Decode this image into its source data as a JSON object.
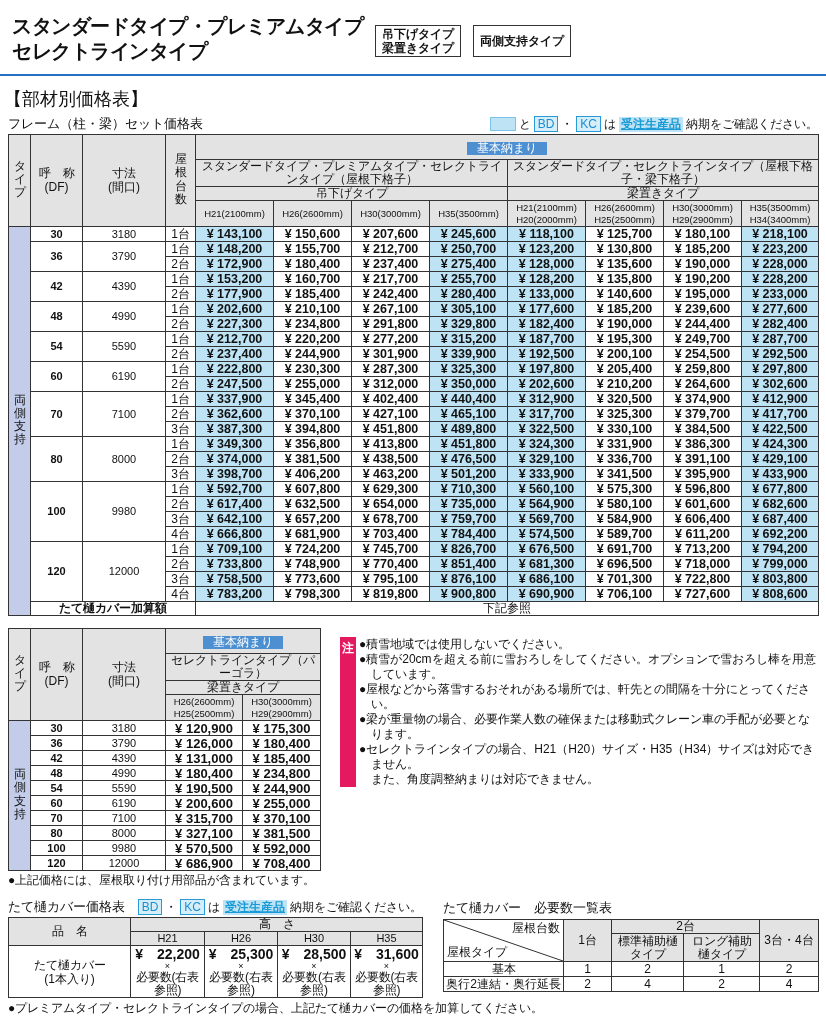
{
  "heading": {
    "title_lines": [
      "スタンダードタイプ・プレミアムタイプ",
      "セレクトラインタイプ"
    ],
    "tags": [
      {
        "lines": [
          "吊下げタイプ",
          "梁置きタイプ"
        ]
      },
      {
        "lines": [
          "両側支持タイプ"
        ]
      }
    ]
  },
  "section_title": "【部材別価格表】",
  "frame_table": {
    "title": "フレーム（柱・梁）セット価格表",
    "legend": [
      {
        "kind": "swatch"
      },
      {
        "kind": "text",
        "text": "と"
      },
      {
        "kind": "code",
        "text": "BD"
      },
      {
        "kind": "text",
        "text": "・"
      },
      {
        "kind": "code",
        "text": "KC"
      },
      {
        "kind": "text",
        "text": "は"
      },
      {
        "kind": "tag",
        "text": "受注生産品"
      },
      {
        "kind": "text",
        "text": "納期をご確認ください。"
      }
    ],
    "headers": {
      "type": "タイプ",
      "name": [
        "呼　称",
        "(DF)"
      ],
      "size": [
        "寸法",
        "(間口)"
      ],
      "count": "屋根台数"
    },
    "badge": "基本納まり",
    "groups": [
      {
        "label": "スタンダードタイプ・プレミアムタイプ・セレクトラインタイプ（屋根下格子）",
        "subtype": "吊下げタイプ"
      },
      {
        "label": "スタンダードタイプ・セレクトラインタイプ（屋根下格子・梁下格子）",
        "subtype": "梁置きタイプ"
      }
    ],
    "price_columns": [
      {
        "lines": [
          "H21(2100mm)"
        ],
        "highlighted": true
      },
      {
        "lines": [
          "H26(2600mm)"
        ],
        "highlighted": false
      },
      {
        "lines": [
          "H30(3000mm)"
        ],
        "highlighted": false
      },
      {
        "lines": [
          "H35(3500mm)"
        ],
        "highlighted": true
      },
      {
        "lines": [
          "H21(2100mm)",
          "H20(2000mm)"
        ],
        "highlighted": true
      },
      {
        "lines": [
          "H26(2600mm)",
          "H25(2500mm)"
        ],
        "highlighted": false
      },
      {
        "lines": [
          "H30(3000mm)",
          "H29(2900mm)"
        ],
        "highlighted": false
      },
      {
        "lines": [
          "H35(3500mm)",
          "H34(3400mm)"
        ],
        "highlighted": true
      }
    ],
    "type_label": "両側支持",
    "rows": [
      {
        "name": "30",
        "size": "3180",
        "units": [
          {
            "count": "1台",
            "prices": [
              "¥ 143,100",
              "¥ 150,600",
              "¥ 207,600",
              "¥ 245,600",
              "¥ 118,100",
              "¥ 125,700",
              "¥ 180,100",
              "¥ 218,100"
            ]
          }
        ]
      },
      {
        "name": "36",
        "size": "3790",
        "units": [
          {
            "count": "1台",
            "prices": [
              "¥ 148,200",
              "¥ 155,700",
              "¥ 212,700",
              "¥ 250,700",
              "¥ 123,200",
              "¥ 130,800",
              "¥ 185,200",
              "¥ 223,200"
            ]
          },
          {
            "count": "2台",
            "prices": [
              "¥ 172,900",
              "¥ 180,400",
              "¥ 237,400",
              "¥ 275,400",
              "¥ 128,000",
              "¥ 135,600",
              "¥ 190,000",
              "¥ 228,000"
            ]
          }
        ]
      },
      {
        "name": "42",
        "size": "4390",
        "units": [
          {
            "count": "1台",
            "prices": [
              "¥ 153,200",
              "¥ 160,700",
              "¥ 217,700",
              "¥ 255,700",
              "¥ 128,200",
              "¥ 135,800",
              "¥ 190,200",
              "¥ 228,200"
            ]
          },
          {
            "count": "2台",
            "prices": [
              "¥ 177,900",
              "¥ 185,400",
              "¥ 242,400",
              "¥ 280,400",
              "¥ 133,000",
              "¥ 140,600",
              "¥ 195,000",
              "¥ 233,000"
            ]
          }
        ]
      },
      {
        "name": "48",
        "size": "4990",
        "units": [
          {
            "count": "1台",
            "prices": [
              "¥ 202,600",
              "¥ 210,100",
              "¥ 267,100",
              "¥ 305,100",
              "¥ 177,600",
              "¥ 185,200",
              "¥ 239,600",
              "¥ 277,600"
            ]
          },
          {
            "count": "2台",
            "prices": [
              "¥ 227,300",
              "¥ 234,800",
              "¥ 291,800",
              "¥ 329,800",
              "¥ 182,400",
              "¥ 190,000",
              "¥ 244,400",
              "¥ 282,400"
            ]
          }
        ]
      },
      {
        "name": "54",
        "size": "5590",
        "units": [
          {
            "count": "1台",
            "prices": [
              "¥ 212,700",
              "¥ 220,200",
              "¥ 277,200",
              "¥ 315,200",
              "¥ 187,700",
              "¥ 195,300",
              "¥ 249,700",
              "¥ 287,700"
            ]
          },
          {
            "count": "2台",
            "prices": [
              "¥ 237,400",
              "¥ 244,900",
              "¥ 301,900",
              "¥ 339,900",
              "¥ 192,500",
              "¥ 200,100",
              "¥ 254,500",
              "¥ 292,500"
            ]
          }
        ]
      },
      {
        "name": "60",
        "size": "6190",
        "units": [
          {
            "count": "1台",
            "prices": [
              "¥ 222,800",
              "¥ 230,300",
              "¥ 287,300",
              "¥ 325,300",
              "¥ 197,800",
              "¥ 205,400",
              "¥ 259,800",
              "¥ 297,800"
            ]
          },
          {
            "count": "2台",
            "prices": [
              "¥ 247,500",
              "¥ 255,000",
              "¥ 312,000",
              "¥ 350,000",
              "¥ 202,600",
              "¥ 210,200",
              "¥ 264,600",
              "¥ 302,600"
            ]
          }
        ]
      },
      {
        "name": "70",
        "size": "7100",
        "units": [
          {
            "count": "1台",
            "prices": [
              "¥ 337,900",
              "¥ 345,400",
              "¥ 402,400",
              "¥ 440,400",
              "¥ 312,900",
              "¥ 320,500",
              "¥ 374,900",
              "¥ 412,900"
            ]
          },
          {
            "count": "2台",
            "prices": [
              "¥ 362,600",
              "¥ 370,100",
              "¥ 427,100",
              "¥ 465,100",
              "¥ 317,700",
              "¥ 325,300",
              "¥ 379,700",
              "¥ 417,700"
            ]
          },
          {
            "count": "3台",
            "prices": [
              "¥ 387,300",
              "¥ 394,800",
              "¥ 451,800",
              "¥ 489,800",
              "¥ 322,500",
              "¥ 330,100",
              "¥ 384,500",
              "¥ 422,500"
            ]
          }
        ]
      },
      {
        "name": "80",
        "size": "8000",
        "units": [
          {
            "count": "1台",
            "prices": [
              "¥ 349,300",
              "¥ 356,800",
              "¥ 413,800",
              "¥ 451,800",
              "¥ 324,300",
              "¥ 331,900",
              "¥ 386,300",
              "¥ 424,300"
            ]
          },
          {
            "count": "2台",
            "prices": [
              "¥ 374,000",
              "¥ 381,500",
              "¥ 438,500",
              "¥ 476,500",
              "¥ 329,100",
              "¥ 336,700",
              "¥ 391,100",
              "¥ 429,100"
            ]
          },
          {
            "count": "3台",
            "prices": [
              "¥ 398,700",
              "¥ 406,200",
              "¥ 463,200",
              "¥ 501,200",
              "¥ 333,900",
              "¥ 341,500",
              "¥ 395,900",
              "¥ 433,900"
            ]
          }
        ]
      },
      {
        "name": "100",
        "size": "9980",
        "units": [
          {
            "count": "1台",
            "prices": [
              "¥ 592,700",
              "¥ 607,800",
              "¥ 629,300",
              "¥ 710,300",
              "¥ 560,100",
              "¥ 575,300",
              "¥ 596,800",
              "¥ 677,800"
            ]
          },
          {
            "count": "2台",
            "prices": [
              "¥ 617,400",
              "¥ 632,500",
              "¥ 654,000",
              "¥ 735,000",
              "¥ 564,900",
              "¥ 580,100",
              "¥ 601,600",
              "¥ 682,600"
            ]
          },
          {
            "count": "3台",
            "prices": [
              "¥ 642,100",
              "¥ 657,200",
              "¥ 678,700",
              "¥ 759,700",
              "¥ 569,700",
              "¥ 584,900",
              "¥ 606,400",
              "¥ 687,400"
            ]
          },
          {
            "count": "4台",
            "prices": [
              "¥ 666,800",
              "¥ 681,900",
              "¥ 703,400",
              "¥ 784,400",
              "¥ 574,500",
              "¥ 589,700",
              "¥ 611,200",
              "¥ 692,200"
            ]
          }
        ]
      },
      {
        "name": "120",
        "size": "12000",
        "units": [
          {
            "count": "1台",
            "prices": [
              "¥ 709,100",
              "¥ 724,200",
              "¥ 745,700",
              "¥ 826,700",
              "¥ 676,500",
              "¥ 691,700",
              "¥ 713,200",
              "¥ 794,200"
            ]
          },
          {
            "count": "2台",
            "prices": [
              "¥ 733,800",
              "¥ 748,900",
              "¥ 770,400",
              "¥ 851,400",
              "¥ 681,300",
              "¥ 696,500",
              "¥ 718,000",
              "¥ 799,000"
            ]
          },
          {
            "count": "3台",
            "prices": [
              "¥ 758,500",
              "¥ 773,600",
              "¥ 795,100",
              "¥ 876,100",
              "¥ 686,100",
              "¥ 701,300",
              "¥ 722,800",
              "¥ 803,800"
            ]
          },
          {
            "count": "4台",
            "prices": [
              "¥ 783,200",
              "¥ 798,300",
              "¥ 819,800",
              "¥ 900,800",
              "¥ 690,900",
              "¥ 706,100",
              "¥ 727,600",
              "¥ 808,600"
            ]
          }
        ]
      }
    ],
    "footer": {
      "label": "たて樋カバー加算額",
      "value": "下記参照"
    }
  },
  "selectline_table": {
    "headers": {
      "type": "タイプ",
      "name": [
        "呼　称",
        "(DF)"
      ],
      "size": [
        "寸法",
        "(間口)"
      ]
    },
    "badge": "基本納まり",
    "group": "セレクトラインタイプ（パーゴラ）",
    "subtype": "梁置きタイプ",
    "price_columns": [
      {
        "lines": [
          "H26(2600mm)",
          "H25(2500mm)"
        ]
      },
      {
        "lines": [
          "H30(3000mm)",
          "H29(2900mm)"
        ]
      }
    ],
    "type_label": "両側支持",
    "rows": [
      {
        "name": "30",
        "size": "3180",
        "prices": [
          "¥ 120,900",
          "¥ 175,300"
        ]
      },
      {
        "name": "36",
        "size": "3790",
        "prices": [
          "¥ 126,000",
          "¥ 180,400"
        ]
      },
      {
        "name": "42",
        "size": "4390",
        "prices": [
          "¥ 131,000",
          "¥ 185,400"
        ]
      },
      {
        "name": "48",
        "size": "4990",
        "prices": [
          "¥ 180,400",
          "¥ 234,800"
        ]
      },
      {
        "name": "54",
        "size": "5590",
        "prices": [
          "¥ 190,500",
          "¥ 244,900"
        ]
      },
      {
        "name": "60",
        "size": "6190",
        "prices": [
          "¥ 200,600",
          "¥ 255,000"
        ]
      },
      {
        "name": "70",
        "size": "7100",
        "prices": [
          "¥ 315,700",
          "¥ 370,100"
        ]
      },
      {
        "name": "80",
        "size": "8000",
        "prices": [
          "¥ 327,100",
          "¥ 381,500"
        ]
      },
      {
        "name": "100",
        "size": "9980",
        "prices": [
          "¥ 570,500",
          "¥ 592,000"
        ]
      },
      {
        "name": "120",
        "size": "12000",
        "prices": [
          "¥ 686,900",
          "¥ 708,400"
        ]
      }
    ],
    "footnote": "●上記価格には、屋根取り付け用部品が含まれています。"
  },
  "notes": {
    "marker": "注",
    "items": [
      {
        "kind": "bullet",
        "text": "●積雪地域では使用しないでください。"
      },
      {
        "kind": "bullet",
        "text": "●積雪が20cmを超える前に雪おろしをしてください。オプションで雪おろし棒を用意しています。"
      },
      {
        "kind": "bullet",
        "text": "●屋根などから落雪するおそれがある場所では、軒先との間隔を十分にとってください。"
      },
      {
        "kind": "bullet",
        "text": "●梁が重量物の場合、必要作業人数の確保または移動式クレーン車の手配が必要となります。"
      },
      {
        "kind": "bullet",
        "text": "●セレクトラインタイプの場合、H21（H20）サイズ・H35（H34）サイズは対応できません。"
      },
      {
        "kind": "continuation",
        "text": "また、角度調整納まりは対応できません。"
      }
    ]
  },
  "gutter_price_table": {
    "title": "たて樋カバー価格表",
    "legend": [
      {
        "kind": "code",
        "text": "BD"
      },
      {
        "kind": "text",
        "text": "・"
      },
      {
        "kind": "code",
        "text": "KC"
      },
      {
        "kind": "text",
        "text": "は"
      },
      {
        "kind": "tag",
        "text": "受注生産品"
      },
      {
        "kind": "text",
        "text": "納期をご確認ください。"
      }
    ],
    "item_header": "品　名",
    "height_header": "高　さ",
    "heights": [
      "H21",
      "H26",
      "H30",
      "H35"
    ],
    "item": [
      "たて樋カバー",
      "(1本入り)"
    ],
    "cells": [
      {
        "price": "¥　22,200",
        "times": "×",
        "note": "必要数(右表参照)"
      },
      {
        "price": "¥　25,300",
        "times": "×",
        "note": "必要数(右表参照)"
      },
      {
        "price": "¥　28,500",
        "times": "×",
        "note": "必要数(右表参照)"
      },
      {
        "price": "¥　31,600",
        "times": "×",
        "note": "必要数(右表参照)"
      }
    ],
    "footnote": "●プレミアムタイプ・セレクトラインタイプの場合、上記たて樋カバーの価格を加算してください。"
  },
  "required_table": {
    "title": "たて樋カバー　必要数一覧表",
    "corner_top": "屋根台数",
    "corner_bottom": "屋根タイプ",
    "one": "1台",
    "two": "2台",
    "two_subs": [
      "標準補助樋タイプ",
      "ロング補助樋タイプ"
    ],
    "three_four": "3台・4台",
    "rows": [
      {
        "label": "基本",
        "values": [
          "1",
          "2",
          "1",
          "2"
        ]
      },
      {
        "label": "奥行2連結・奥行延長",
        "values": [
          "2",
          "4",
          "2",
          "4"
        ]
      }
    ]
  }
}
